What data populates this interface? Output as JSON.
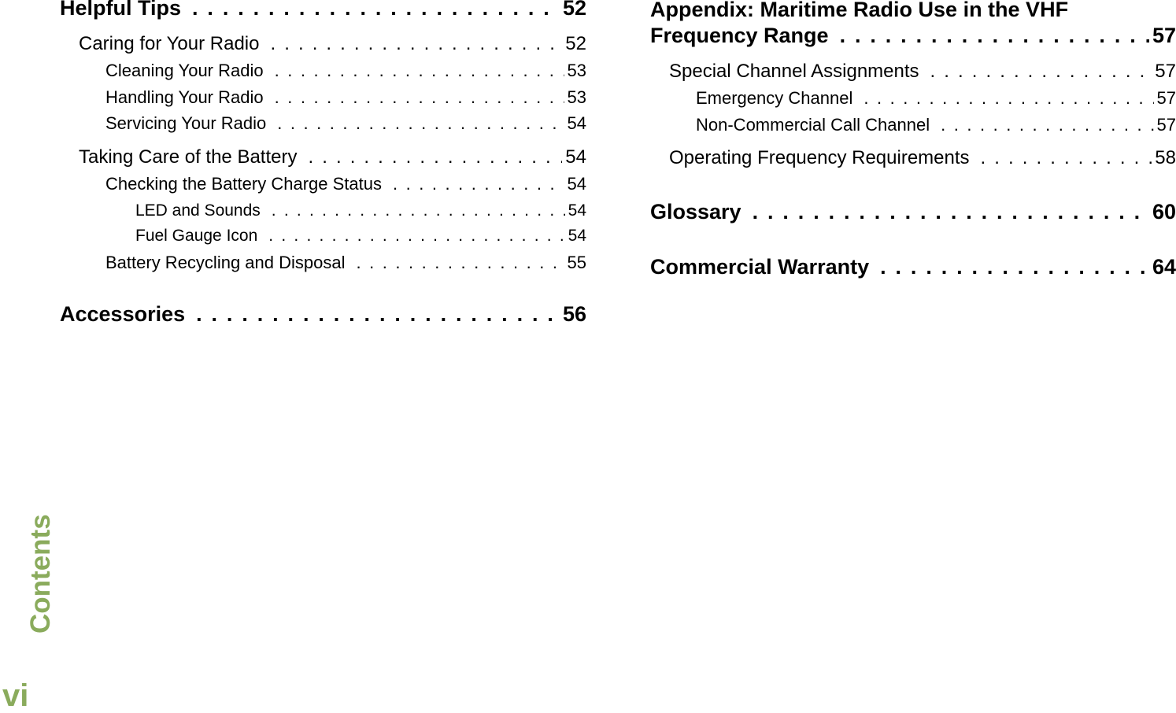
{
  "side_tab": {
    "label": "Contents",
    "color": "#8aab5c"
  },
  "page_number": "vi",
  "left_column": [
    {
      "label": "Helpful Tips",
      "page": "52"
    },
    {
      "label": "Caring for Your Radio",
      "page": "52"
    },
    {
      "label": "Cleaning Your Radio",
      "page": "53"
    },
    {
      "label": "Handling Your Radio",
      "page": "53"
    },
    {
      "label": "Servicing Your Radio",
      "page": "54"
    },
    {
      "label": "Taking Care of the Battery",
      "page": "54"
    },
    {
      "label": "Checking the Battery Charge Status",
      "page": "54"
    },
    {
      "label": "LED and Sounds",
      "page": "54"
    },
    {
      "label": "Fuel Gauge Icon",
      "page": "54"
    },
    {
      "label": "Battery Recycling and Disposal",
      "page": "55"
    },
    {
      "label": "Accessories",
      "page": "56"
    }
  ],
  "right_column": {
    "appendix_line1": "Appendix: Maritime Radio Use in the VHF",
    "entries": [
      {
        "label": "Frequency Range",
        "page": "57"
      },
      {
        "label": "Special Channel Assignments",
        "page": "57"
      },
      {
        "label": "Emergency Channel",
        "page": "57"
      },
      {
        "label": "Non-Commercial Call Channel",
        "page": "57"
      },
      {
        "label": "Operating Frequency Requirements",
        "page": "58"
      },
      {
        "label": "Glossary",
        "page": "60"
      },
      {
        "label": "Commercial Warranty",
        "page": "64"
      }
    ]
  }
}
